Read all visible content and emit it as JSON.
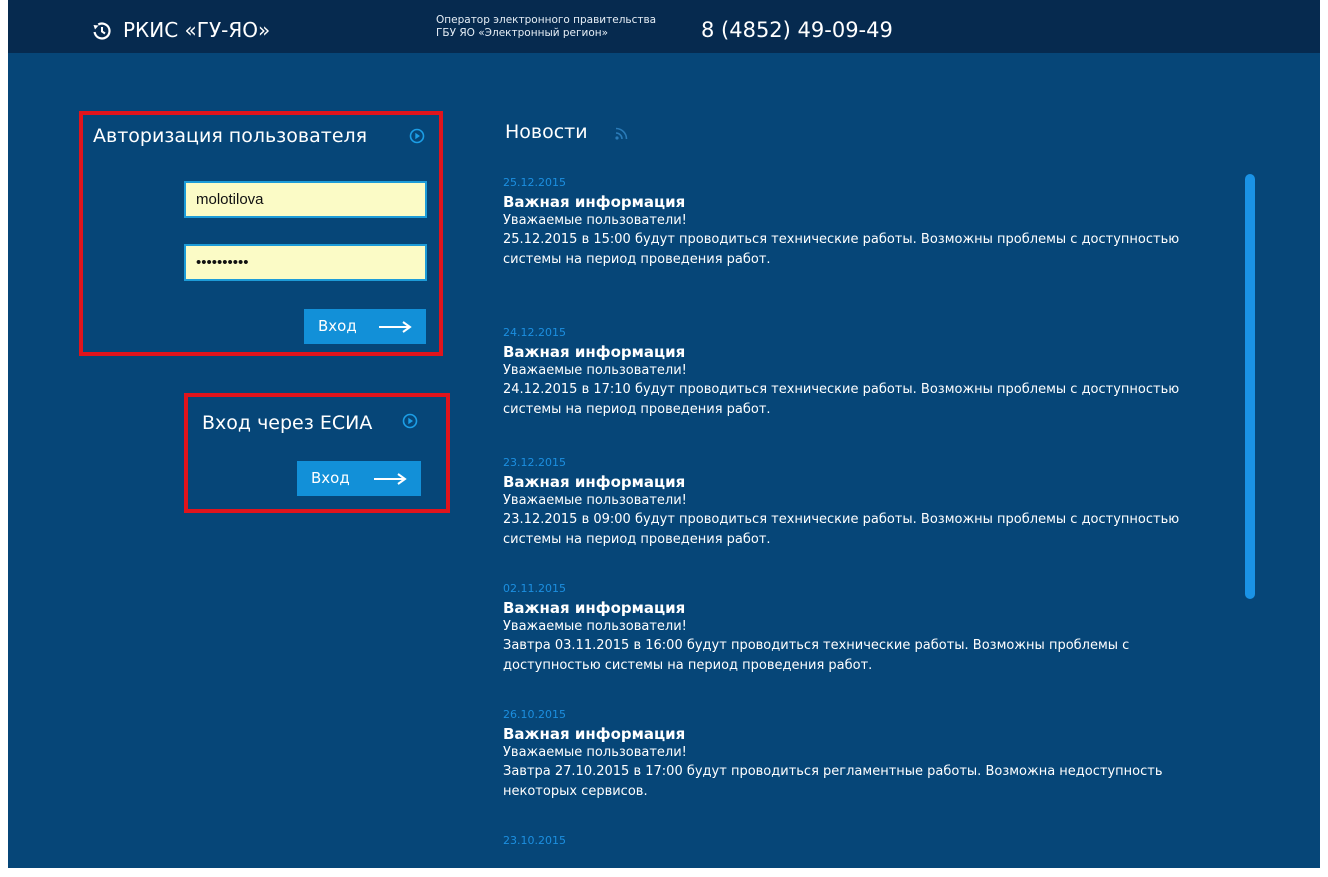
{
  "header": {
    "brand": "РКИС «ГУ-ЯО»",
    "operator_line1": "Оператор электронного правительства",
    "operator_line2": "ГБУ ЯО «Электронный регион»",
    "phone": "8 (4852) 49-09-49",
    "logo_icon": "history-clock-icon"
  },
  "login": {
    "title": "Авторизация пользователя",
    "title_icon": "play-circle-icon",
    "username_value": "molotilova",
    "password_value": "••••••••••",
    "button_label": "Вход",
    "button_icon": "arrow-right-icon"
  },
  "esia": {
    "title": "Вход через ЕСИА",
    "title_icon": "play-circle-icon",
    "button_label": "Вход",
    "button_icon": "arrow-right-icon"
  },
  "news": {
    "title": "Новости",
    "title_icon": "rss-icon",
    "items": [
      {
        "date": "25.12.2015",
        "headline": "Важная информация",
        "greeting": "Уважаемые пользователи!",
        "body": "25.12.2015 в 15:00 будут проводиться технические работы. Возможны проблемы с доступностью системы на период проведения работ."
      },
      {
        "date": "24.12.2015",
        "headline": "Важная информация",
        "greeting": "Уважаемые пользователи!",
        "body": "24.12.2015 в 17:10 будут проводиться технические работы. Возможны проблемы с доступностью системы на период проведения работ."
      },
      {
        "date": "23.12.2015",
        "headline": "Важная информация",
        "greeting": "Уважаемые пользователи!",
        "body": "23.12.2015 в 09:00 будут проводиться технические работы. Возможны проблемы с доступностью системы на период проведения работ."
      },
      {
        "date": "02.11.2015",
        "headline": "Важная информация",
        "greeting": "Уважаемые пользователи!",
        "body": "Завтра 03.11.2015 в 16:00 будут проводиться технические работы. Возможны проблемы с доступностью системы на период проведения работ."
      },
      {
        "date": "26.10.2015",
        "headline": "Важная информация",
        "greeting": "Уважаемые пользователи!",
        "body": "Завтра 27.10.2015 в 17:00 будут проводиться регламентные работы. Возможна недоступность некоторых сервисов."
      },
      {
        "date": "23.10.2015"
      }
    ]
  },
  "colors": {
    "background": "#064678",
    "topbar": "#062a4f",
    "accent": "#1290d8",
    "highlight_border": "#e0141c",
    "input_fill": "#fbfbc6",
    "date_text": "#1c8fe0"
  }
}
